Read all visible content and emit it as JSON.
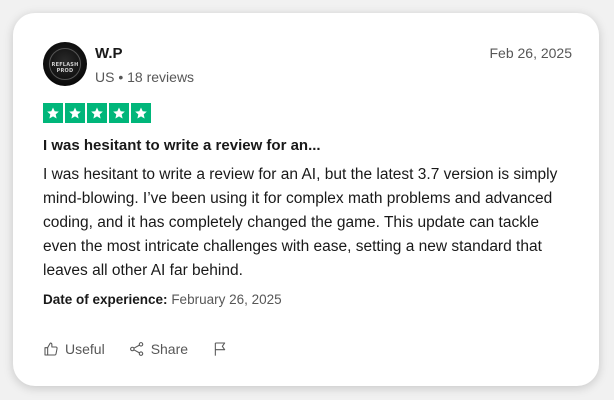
{
  "user": {
    "name": "W.P",
    "country": "US",
    "reviews": "18 reviews",
    "avatar_text": "REFLASH PROD"
  },
  "review": {
    "date": "Feb 26, 2025",
    "rating": 5,
    "star_color": "#00b67a",
    "title": "I was hesitant to write a review for an...",
    "body": "I was hesitant to write a review for an AI, but the latest 3.7 version is simply mind-blowing. I’ve been using it for complex math problems and advanced coding, and it has completely changed the game. This update can tackle even the most intricate challenges with ease, setting a new standard that leaves all other AI far behind.",
    "experience_label": "Date of experience:",
    "experience_date": "February 26, 2025"
  },
  "actions": {
    "useful_label": "Useful",
    "useful_icon": "thumbs-up-icon",
    "share_label": "Share",
    "share_icon": "share-icon",
    "report_icon": "flag-icon"
  }
}
